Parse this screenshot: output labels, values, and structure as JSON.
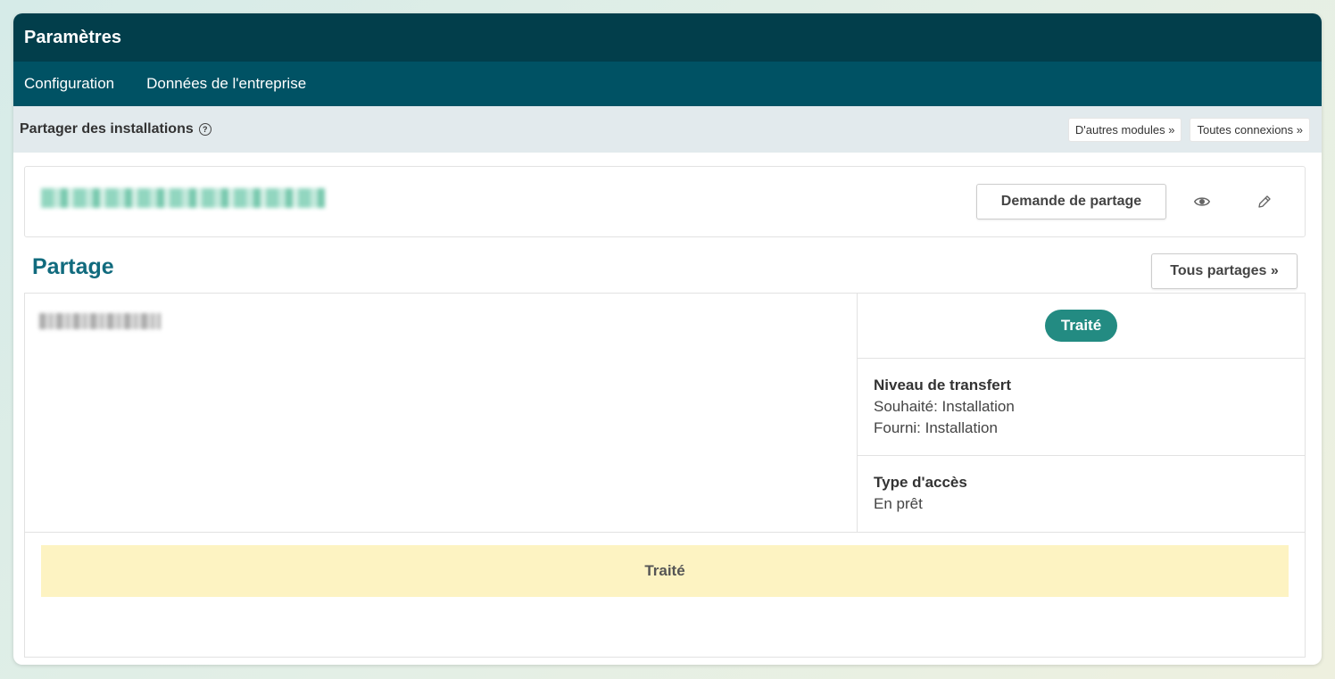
{
  "window": {
    "title": "Paramètres"
  },
  "nav": {
    "items": [
      "Configuration",
      "Données de l'entreprise"
    ]
  },
  "subheader": {
    "title": "Partager des installations",
    "help_icon": "?",
    "buttons": [
      "D'autres modules »",
      "Toutes connexions »"
    ]
  },
  "card": {
    "request_button": "Demande de partage",
    "icons": [
      "eye-icon",
      "pencil-icon"
    ]
  },
  "section": {
    "title": "Partage",
    "all_button": "Tous partages  »"
  },
  "share": {
    "status": "Traité",
    "transfer_level": {
      "label": "Niveau de transfert",
      "desired": "Souhaité: Installation",
      "provided": "Fourni: Installation"
    },
    "access_type": {
      "label": "Type d'accès",
      "value": "En prêt"
    },
    "banner": "Traité"
  },
  "colors": {
    "titlebar": "#023e4b",
    "navbar": "#005264",
    "accent": "#116b7e",
    "badge": "#238b82",
    "banner": "#fdf3c2"
  }
}
